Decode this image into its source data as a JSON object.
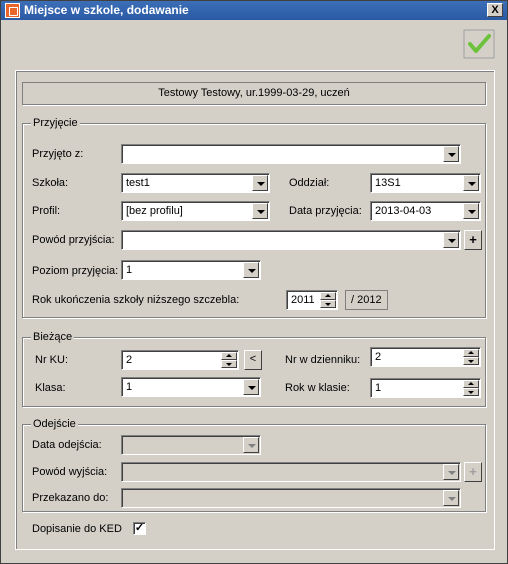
{
  "window": {
    "title": "Miejsce w szkole, dodawanie",
    "close_label": "X"
  },
  "info": "Testowy Testowy, ur.1999-03-29, uczeń",
  "przyjecie": {
    "legend": "Przyjęcie",
    "przyjeto_z_label": "Przyjęto z:",
    "przyjeto_z_value": "",
    "szkola_label": "Szkoła:",
    "szkola_value": "test1",
    "oddzial_label": "Oddział:",
    "oddzial_value": "13S1",
    "profil_label": "Profil:",
    "profil_value": "[bez profilu]",
    "data_label": "Data przyjęcia:",
    "data_value": "2013-04-03",
    "powod_label": "Powód przyjścia:",
    "powod_value": "",
    "poziom_label": "Poziom przyjęcia:",
    "poziom_value": "1",
    "rok_label": "Rok ukończenia szkoły niższego szczebla:",
    "rok_value": "2011",
    "rok_suffix": "/ 2012"
  },
  "biezace": {
    "legend": "Bieżące",
    "nr_ku_label": "Nr KU:",
    "nr_ku_value": "2",
    "nr_ku_btn": "<",
    "nr_dz_label": "Nr w dzienniku:",
    "nr_dz_value": "2",
    "klasa_label": "Klasa:",
    "klasa_value": "1",
    "rok_klasie_label": "Rok w klasie:",
    "rok_klasie_value": "1"
  },
  "odejscie": {
    "legend": "Odejście",
    "data_label": "Data odejścia:",
    "powod_label": "Powód wyjścia:",
    "przekazano_label": "Przekazano do:"
  },
  "ked": {
    "label": "Dopisanie do KED",
    "checked": "✓"
  },
  "plus": "+",
  "colors": {
    "titlebar": "#2a5aa3",
    "ok_check": "#5cb82e"
  }
}
